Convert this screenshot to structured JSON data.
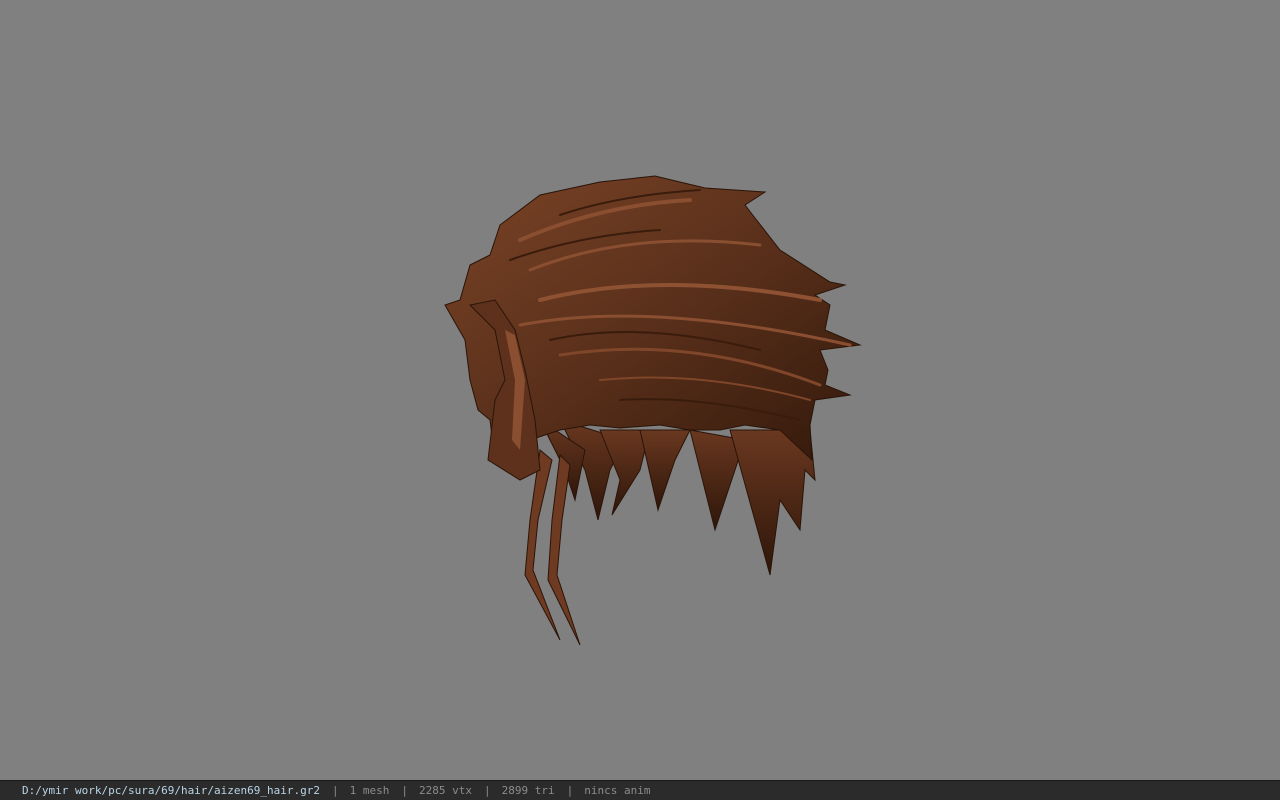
{
  "viewport": {
    "background_color": "#808080",
    "model_name": "hair-model"
  },
  "status_bar": {
    "file_path": "D:/ymir work/pc/sura/69/hair/aizen69_hair.gr2",
    "mesh_count": "1 mesh",
    "vertex_count": "2285 vtx",
    "triangle_count": "2899 tri",
    "anim_status": "nincs anim",
    "separator": "|"
  },
  "colors": {
    "hair_base": "#5a301b",
    "hair_highlight": "#8a4e30",
    "hair_shadow": "#2e160a",
    "status_path": "#b9d4e6",
    "status_text": "#8c8c8c"
  }
}
